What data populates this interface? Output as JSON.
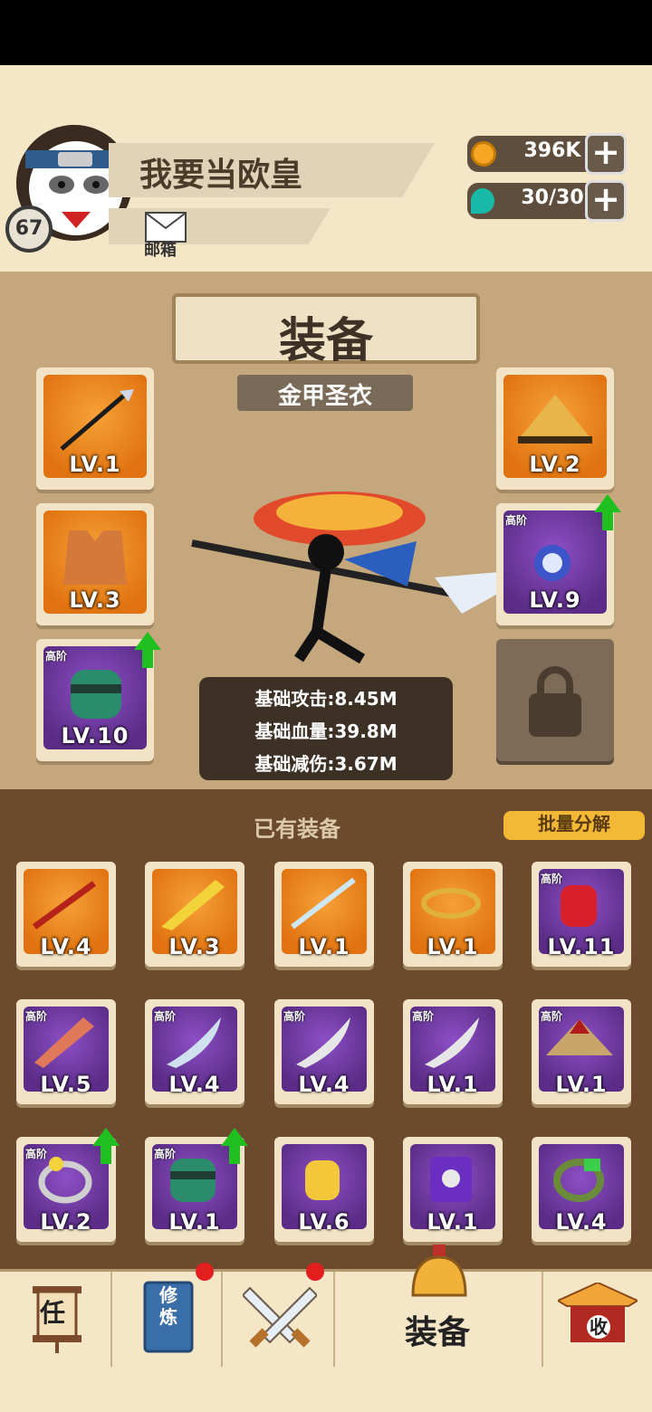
{
  "player": {
    "name": "我要当欧皇",
    "level": "67",
    "mail_label": "邮箱"
  },
  "resources": {
    "gold": "396K",
    "stamina": "30/30"
  },
  "equip_panel": {
    "title": "装备",
    "subtitle": "金甲圣衣",
    "slots": [
      {
        "level": "LV.1",
        "tier": "",
        "item": "spear"
      },
      {
        "level": "LV.2",
        "tier": "",
        "item": "straw-hat"
      },
      {
        "level": "LV.3",
        "tier": "",
        "item": "armor-vest"
      },
      {
        "level": "LV.9",
        "tier": "高阶",
        "item": "gem-necklace"
      },
      {
        "level": "LV.10",
        "tier": "高阶",
        "item": "jade-bracer"
      }
    ],
    "stats": [
      "基础攻击:8.45M",
      "基础血量:39.8M",
      "基础减伤:3.67M"
    ]
  },
  "inventory": {
    "header": "已有装备",
    "dismantle_label": "批量分解",
    "items": [
      {
        "level": "LV.4",
        "tier": "",
        "item": "staff"
      },
      {
        "level": "LV.3",
        "tier": "",
        "item": "golden-sword"
      },
      {
        "level": "LV.1",
        "tier": "",
        "item": "blue-sword"
      },
      {
        "level": "LV.1",
        "tier": "",
        "item": "gold-ring"
      },
      {
        "level": "LV.11",
        "tier": "高阶",
        "item": "red-gauntlet"
      },
      {
        "level": "LV.5",
        "tier": "高阶",
        "item": "red-greatsword"
      },
      {
        "level": "LV.4",
        "tier": "高阶",
        "item": "blue-scimitar"
      },
      {
        "level": "LV.4",
        "tier": "高阶",
        "item": "grey-scimitar"
      },
      {
        "level": "LV.1",
        "tier": "高阶",
        "item": "grey-scimitar"
      },
      {
        "level": "LV.1",
        "tier": "高阶",
        "item": "red-straw-hat"
      },
      {
        "level": "LV.2",
        "tier": "高阶",
        "item": "silver-ring"
      },
      {
        "level": "LV.1",
        "tier": "高阶",
        "item": "jade-bracer"
      },
      {
        "level": "LV.6",
        "tier": "",
        "item": "gold-gauntlet"
      },
      {
        "level": "LV.1",
        "tier": "",
        "item": "purple-armor"
      },
      {
        "level": "LV.4",
        "tier": "",
        "item": "green-bracelet"
      }
    ]
  },
  "nav": {
    "task_glyph": "任",
    "train_glyph": "修炼",
    "equip_label": "装备",
    "collect_glyph": "收"
  },
  "colors": {
    "orange_bg": "#e0720f",
    "purple_bg": "#5a2c86",
    "upgrade_arrow": "#21c021",
    "notification_dot": "#e31e1e"
  }
}
